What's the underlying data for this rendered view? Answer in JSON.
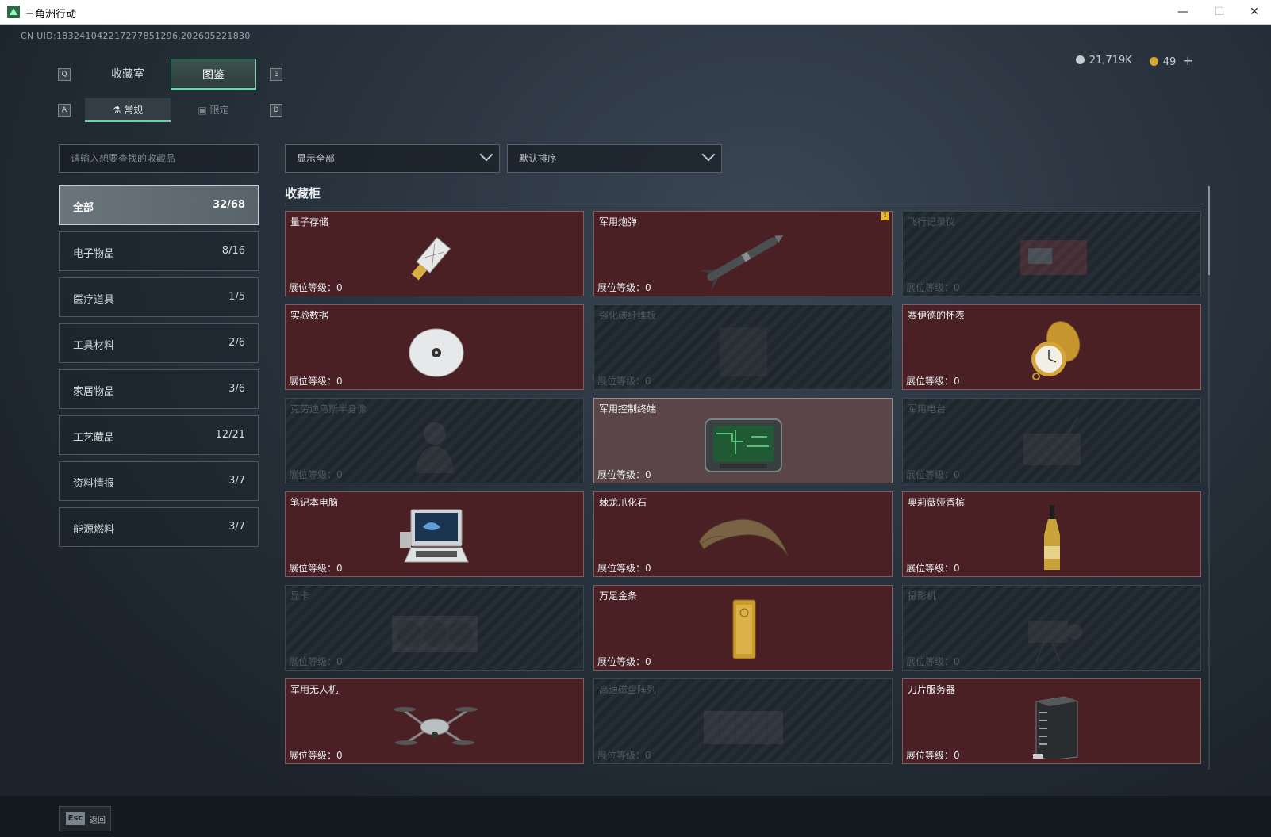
{
  "window": {
    "title": "三角洲行动",
    "minimize": "—",
    "maximize": "☐",
    "close": "✕"
  },
  "header": {
    "uid": "CN UID:183241042217277851296,202605221830",
    "currency_silver": "21,719K",
    "currency_gold": "49",
    "currency_add": "+",
    "silver_color": "#c8ccd0",
    "gold_color": "#d6a83a"
  },
  "tabs": {
    "key_prev": "Q",
    "key_next": "E",
    "items": [
      {
        "label": "收藏室",
        "active": false
      },
      {
        "label": "图鉴",
        "active": true
      }
    ]
  },
  "subtabs": {
    "key_prev": "A",
    "key_next": "D",
    "items": [
      {
        "label": "常规",
        "icon": "flask-icon",
        "active": true
      },
      {
        "label": "限定",
        "icon": "frame-icon",
        "active": false
      }
    ]
  },
  "search": {
    "placeholder": "请输入想要查找的收藏品"
  },
  "filters": {
    "show": "显示全部",
    "sort": "默认排序"
  },
  "categories": [
    {
      "name": "全部",
      "count": "32/68",
      "active": true
    },
    {
      "name": "电子物品",
      "count": "8/16"
    },
    {
      "name": "医疗道具",
      "count": "1/5"
    },
    {
      "name": "工具材料",
      "count": "2/6"
    },
    {
      "name": "家居物品",
      "count": "3/6"
    },
    {
      "name": "工艺藏品",
      "count": "12/21"
    },
    {
      "name": "资料情报",
      "count": "3/7"
    },
    {
      "name": "能源燃料",
      "count": "3/7"
    }
  ],
  "section": {
    "title": "收藏柜"
  },
  "level_label": "展位等级：",
  "items": [
    {
      "name": "量子存储",
      "level": "0",
      "state": "owned",
      "icon": "usb-drive-icon"
    },
    {
      "name": "军用炮弹",
      "level": "0",
      "state": "owned",
      "icon": "missile-icon",
      "badge": "!"
    },
    {
      "name": "飞行记录仪",
      "level": "0",
      "state": "locked",
      "icon": "flight-recorder-icon"
    },
    {
      "name": "实验数据",
      "level": "0",
      "state": "owned",
      "icon": "disc-icon"
    },
    {
      "name": "强化碳纤维板",
      "level": "0",
      "state": "locked",
      "icon": "carbon-plate-icon"
    },
    {
      "name": "赛伊德的怀表",
      "level": "0",
      "state": "owned",
      "icon": "pocket-watch-icon"
    },
    {
      "name": "克劳迪乌斯半身像",
      "level": "0",
      "state": "locked",
      "icon": "bust-icon"
    },
    {
      "name": "军用控制终端",
      "level": "0",
      "state": "highlight",
      "icon": "control-terminal-icon"
    },
    {
      "name": "军用电台",
      "level": "0",
      "state": "locked",
      "icon": "radio-icon"
    },
    {
      "name": "笔记本电脑",
      "level": "0",
      "state": "owned",
      "icon": "laptop-icon"
    },
    {
      "name": "棘龙爪化石",
      "level": "0",
      "state": "owned",
      "icon": "claw-fossil-icon"
    },
    {
      "name": "奥莉薇娅香槟",
      "level": "0",
      "state": "owned",
      "icon": "champagne-icon"
    },
    {
      "name": "显卡",
      "level": "0",
      "state": "locked",
      "icon": "graphics-card-icon"
    },
    {
      "name": "万足金条",
      "level": "0",
      "state": "owned",
      "icon": "gold-bar-icon"
    },
    {
      "name": "摄影机",
      "level": "0",
      "state": "locked",
      "icon": "camera-icon"
    },
    {
      "name": "军用无人机",
      "level": "0",
      "state": "owned",
      "icon": "drone-icon"
    },
    {
      "name": "高速磁盘阵列",
      "level": "0",
      "state": "locked",
      "icon": "disk-array-icon"
    },
    {
      "name": "刀片服务器",
      "level": "0",
      "state": "owned",
      "icon": "blade-server-icon"
    }
  ],
  "footer": {
    "key": "Esc",
    "label": "返回"
  }
}
